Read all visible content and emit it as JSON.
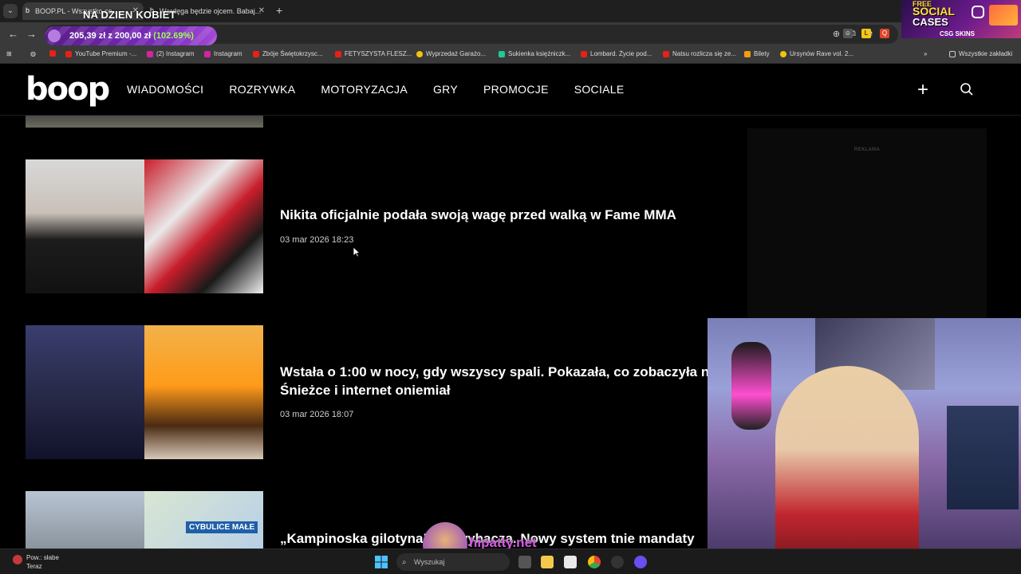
{
  "browser": {
    "tabs": [
      {
        "label": "BOOP.PL - Wszystko co..."
      },
      {
        "label": "Wardęga będzie ojcem. Babaj..."
      }
    ],
    "new_tab_label": "+",
    "bookmarks": [
      {
        "label": "YouTube Premium -...",
        "color": "#e62117"
      },
      {
        "label": "(2) Instagram",
        "color": "#d6249f"
      },
      {
        "label": "Instagram",
        "color": "#d6249f"
      },
      {
        "label": "Zbóje Świętokrzysc...",
        "color": "#e62117"
      },
      {
        "label": "FETYSZYSTA FLESZ...",
        "color": "#e62117"
      },
      {
        "label": "Wyprzedaż Garażo...",
        "color": "#f1c40f"
      },
      {
        "label": "Sukienka księżniczk...",
        "color": "#20c997"
      },
      {
        "label": "Lombard. Życie pod...",
        "color": "#e62117"
      },
      {
        "label": "Natsu rozlicza się ze...",
        "color": "#e62117"
      },
      {
        "label": "Bilety",
        "color": "#f39c12"
      },
      {
        "label": "Ursynów Rave vol. 2...",
        "color": "#f1c40f"
      }
    ],
    "all_bookmarks_label": "Wszystkie zakładki",
    "more_label": "»"
  },
  "overlay": {
    "stream_title": "NA DZIEN KOBIET",
    "goal_text": "205,39 zł z 200,00 zł",
    "goal_pct": "(102.69%)",
    "promo": {
      "line1": "FREE",
      "line2": "SOCIAL",
      "line3": "CASES",
      "brand": "CSG SKINS"
    },
    "watermark": "hipatty.net"
  },
  "site": {
    "logo": "boop",
    "nav": [
      "WIADOMOŚCI",
      "ROZRYWKA",
      "MOTORYZACJA",
      "GRY",
      "PROMOCJE",
      "SOCIALE"
    ],
    "plus_label": "+",
    "ad_label": "REKLAMA",
    "articles": [
      {
        "title": "Nikita oficjalnie podała swoją wagę przed walką w Fame MMA",
        "date": "03 mar 2026 18:23"
      },
      {
        "title": "Wstała o 1:00 w nocy, gdy wszyscy spali. Pokazała, co zobaczyła na",
        "title2": "Śnieżce i internet oniemiał",
        "date": "03 mar 2026 18:07"
      },
      {
        "title": "„Kampinoska gilotyna” nie wybacza. Nowy system tnie mandaty",
        "map_label": "CYBULICE MAŁE"
      }
    ]
  },
  "taskbar": {
    "weather_line1": "Pow.: słabe",
    "weather_line2": "Teraz",
    "search_placeholder": "Wyszukaj"
  }
}
